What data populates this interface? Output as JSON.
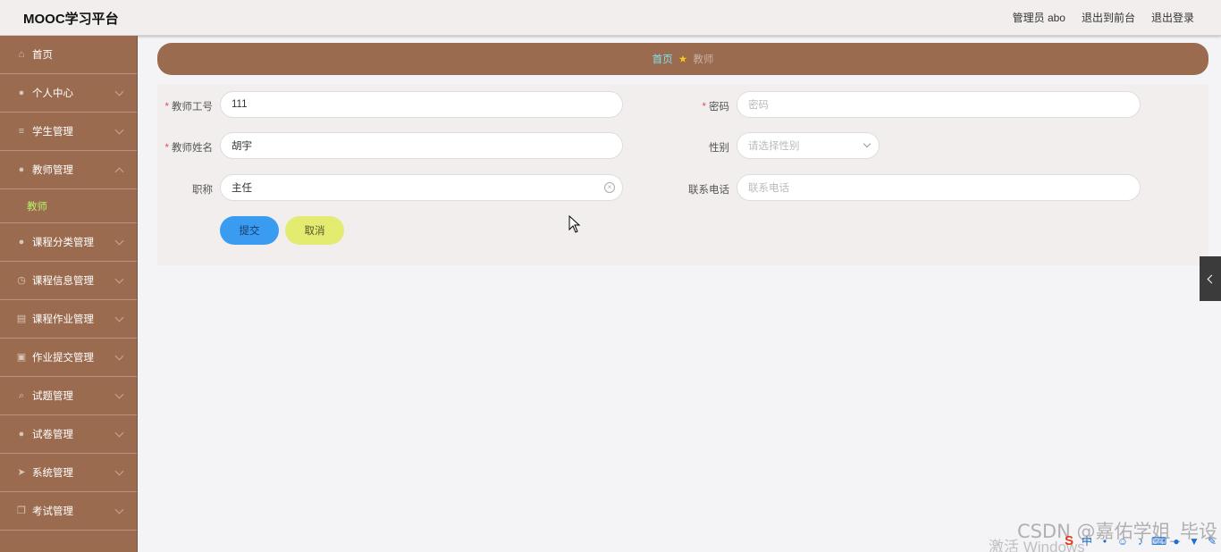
{
  "header": {
    "brand": "MOOC学习平台",
    "user": "管理员 abo",
    "to_front": "退出到前台",
    "logout": "退出登录"
  },
  "sidebar": {
    "items": [
      {
        "label": "首页",
        "icon": "home-icon"
      },
      {
        "label": "个人中心",
        "icon": "user-icon"
      },
      {
        "label": "学生管理",
        "icon": "list-icon"
      },
      {
        "label": "教师管理",
        "icon": "pin-icon",
        "expanded": true,
        "sub": "教师"
      },
      {
        "label": "课程分类管理",
        "icon": "user-icon"
      },
      {
        "label": "课程信息管理",
        "icon": "clock-icon"
      },
      {
        "label": "课程作业管理",
        "icon": "doc-icon"
      },
      {
        "label": "作业提交管理",
        "icon": "clipboard-icon"
      },
      {
        "label": "试题管理",
        "icon": "search-icon"
      },
      {
        "label": "试卷管理",
        "icon": "user-icon"
      },
      {
        "label": "系统管理",
        "icon": "send-icon"
      },
      {
        "label": "考试管理",
        "icon": "copy-icon"
      }
    ]
  },
  "breadcrumb": {
    "home": "首页",
    "current": "教师"
  },
  "form": {
    "teacher_no": {
      "label": "教师工号",
      "value": "111"
    },
    "password": {
      "label": "密码",
      "placeholder": "密码"
    },
    "teacher_name": {
      "label": "教师姓名",
      "value": "胡宇"
    },
    "gender": {
      "label": "性别",
      "placeholder": "请选择性别"
    },
    "title": {
      "label": "职称",
      "value": "主任"
    },
    "phone": {
      "label": "联系电话",
      "placeholder": "联系电话"
    },
    "submit": "提交",
    "cancel": "取消"
  },
  "overlay": {
    "watermark": "CSDN @嘉佑学姐_毕设",
    "windows_activate": "激活 Windows"
  },
  "colors": {
    "sidebar_bg": "#9b6b4f",
    "submit_btn": "#3a9cf0",
    "cancel_btn": "#e3ec70",
    "active_sub": "#b7f16b"
  }
}
